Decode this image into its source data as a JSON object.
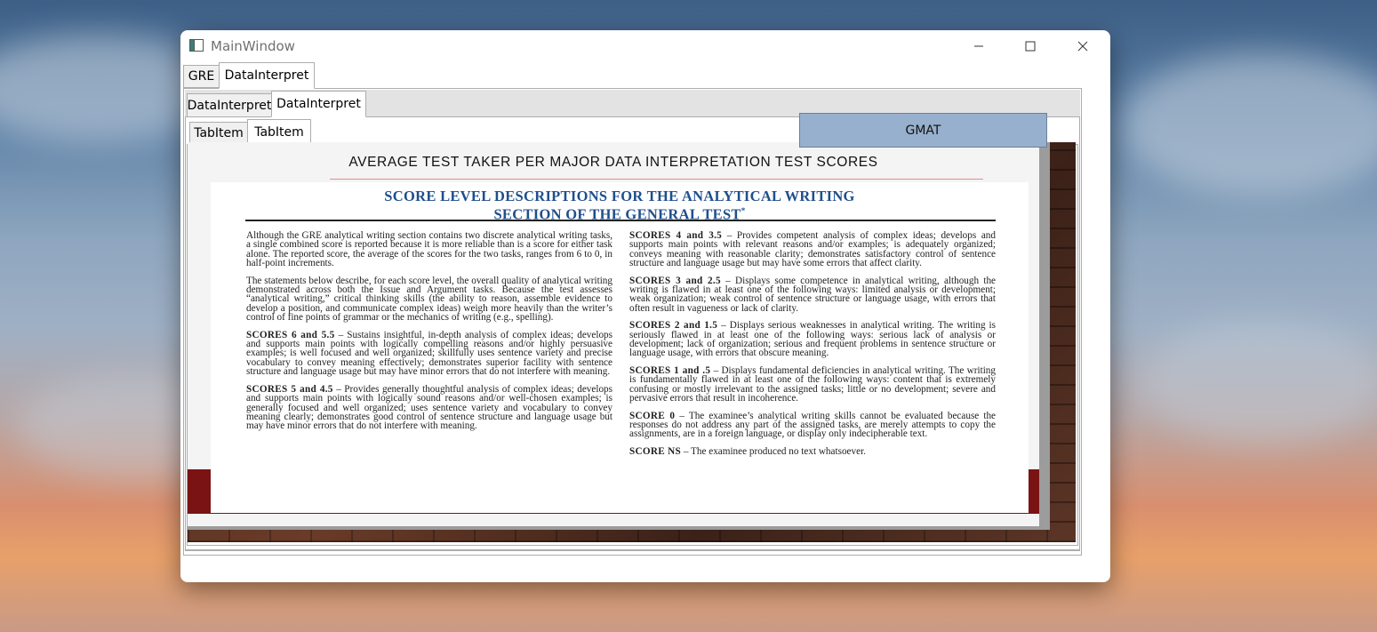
{
  "window": {
    "title": "MainWindow",
    "controls": {
      "minimize": "minimize-icon",
      "maximize": "maximize-icon",
      "close": "close-icon"
    }
  },
  "outer_tabs": [
    "GRE",
    "DataInterpret"
  ],
  "middle_tabs": [
    "DataInterpret",
    "DataInterpret"
  ],
  "inner_tabs": [
    "TabItem",
    "TabItem"
  ],
  "gmat_button": "GMAT",
  "slide": {
    "heading": "AVERAGE TEST TAKER PER MAJOR DATA INTERPRETATION TEST SCORES",
    "paper_title_line1": "SCORE LEVEL DESCRIPTIONS FOR THE ANALYTICAL WRITING",
    "paper_title_line2": "SECTION OF THE GENERAL TEST",
    "paper_title_mark": "*",
    "left": {
      "p1": "Although the GRE analytical writing section contains two discrete analytical writing tasks, a single combined score is reported because it is more reliable than is a score for either task alone. The reported score, the average of the scores for the two tasks, ranges from 6 to 0, in half-point increments.",
      "p2": "The statements below describe, for each score level, the overall quality of analytical writing demonstrated across both the Issue and Argument tasks. Because the test assesses “analytical writing,” critical thinking skills (the ability to reason, assemble evidence to develop a position, and communicate complex ideas) weigh more heavily than the writer’s control of fine points of grammar or the mechanics of writing (e.g., spelling).",
      "s6_label": "SCORES 6 and 5.5",
      "s6_text": " – Sustains insightful, in-depth analysis of complex ideas; develops and supports main points with logically compelling reasons and/or highly persuasive examples; is well focused and well organized; skillfully uses sentence variety and precise vocabulary to convey meaning effectively; demonstrates superior facility with sentence structure and language usage but may have minor errors that do not interfere with meaning.",
      "s5_label": "SCORES 5 and 4.5",
      "s5_text": " – Provides generally thoughtful analysis of complex ideas; develops and supports main points with logically sound reasons and/or well-chosen examples; is generally focused and well organized; uses sentence variety and vocabulary to convey meaning clearly; demonstrates good control of sentence structure and language usage but may have minor errors that do not interfere with meaning."
    },
    "right": {
      "s4_label": "SCORES 4 and 3.5",
      "s4_text": " – Provides competent analysis of complex ideas; develops and supports main points with relevant reasons and/or examples; is adequately organized; conveys meaning with reasonable clarity; demonstrates satisfactory control of sentence structure and language usage but may have some errors that affect clarity.",
      "s3_label": "SCORES 3 and 2.5",
      "s3_text": " – Displays some competence in analytical writing, although the writing is flawed in at least one of the following ways: limited analysis or development; weak organization; weak control of sentence structure or language usage, with errors that often result in vagueness or lack of clarity.",
      "s2_label": "SCORES 2 and 1.5",
      "s2_text": " – Displays serious weaknesses in analytical writing. The writing is seriously flawed in at least one of the following ways: serious lack of analysis or development; lack of organization; serious and frequent problems in sentence structure or language usage, with errors that obscure meaning.",
      "s1_label": "SCORES 1 and .5",
      "s1_text": " – Displays fundamental deficiencies in analytical writing. The writing is fundamentally flawed in at least one of the following ways: content that is extremely confusing or mostly irrelevant to the assigned tasks; little or no development; severe and pervasive errors that result in incoherence.",
      "s0_label": "SCORE 0",
      "s0_text": " – The examinee’s analytical writing skills cannot be evaluated because the responses do not address any part of the assigned tasks, are merely attempts to copy the assignments, are in a foreign language, or display only indecipherable text.",
      "sns_label": "SCORE NS",
      "sns_text": " – The examinee produced no text whatsoever."
    }
  }
}
